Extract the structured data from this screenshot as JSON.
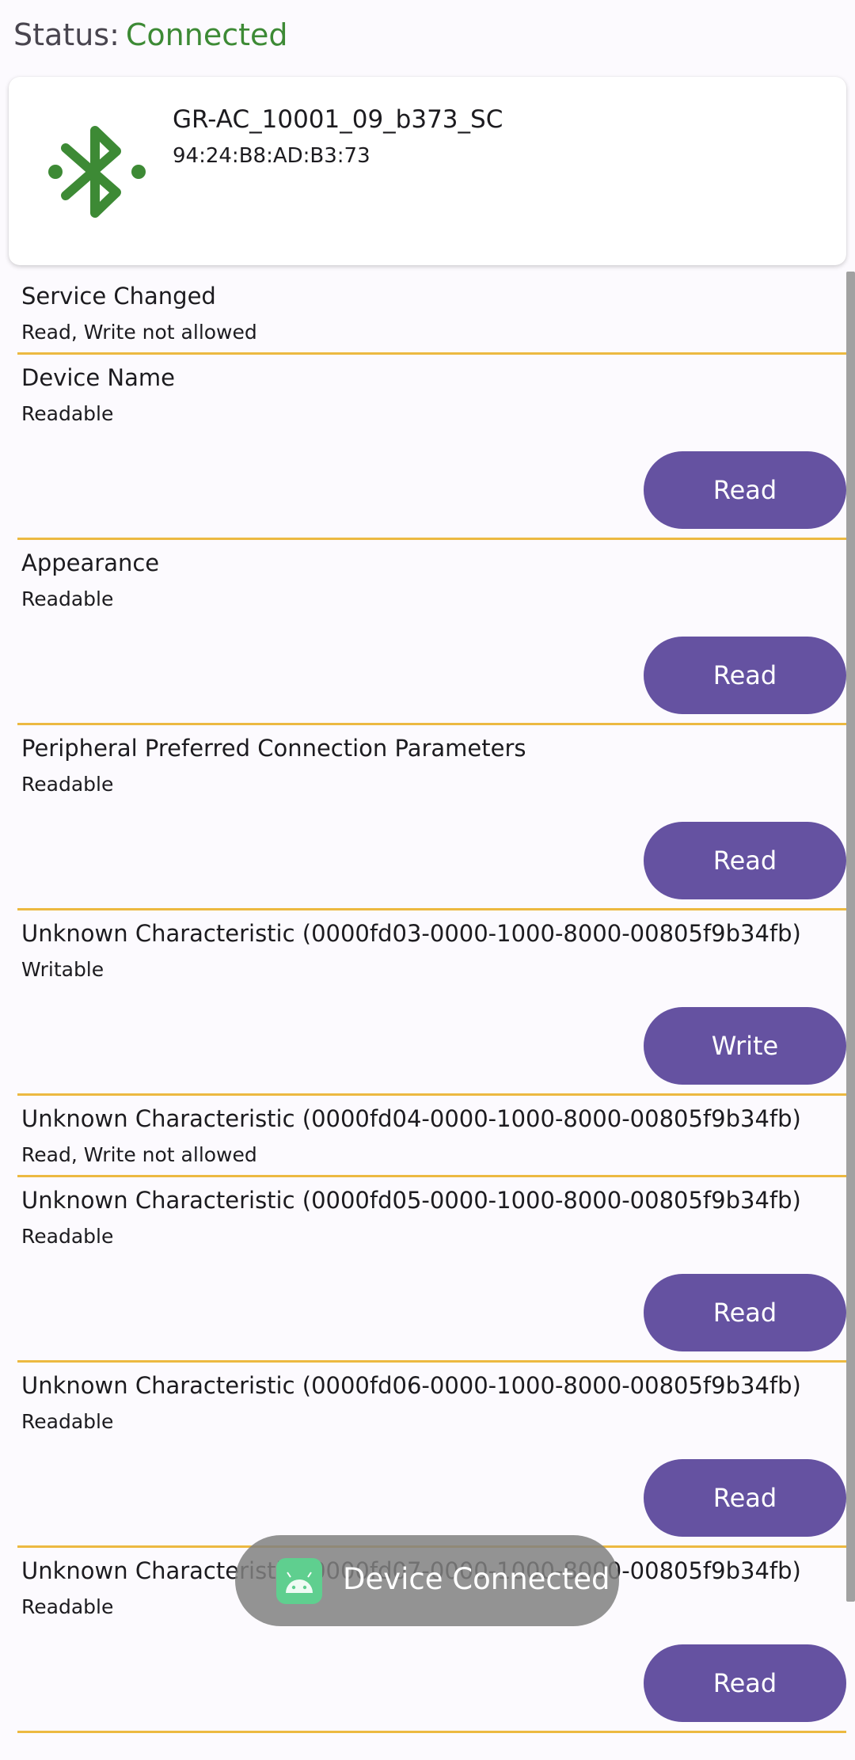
{
  "status": {
    "label": "Status:",
    "value": "Connected"
  },
  "device": {
    "name": "GR-AC_10001_09_b373_SC",
    "mac": "94:24:B8:AD:B3:73",
    "icon": "bluetooth-icon"
  },
  "characteristics": [
    {
      "name": "Service Changed",
      "property": "Read, Write not allowed",
      "action": ""
    },
    {
      "name": "Device Name",
      "property": "Readable",
      "action": "Read"
    },
    {
      "name": "Appearance",
      "property": "Readable",
      "action": "Read"
    },
    {
      "name": "Peripheral Preferred Connection Parameters",
      "property": "Readable",
      "action": "Read"
    },
    {
      "name": "Unknown Characteristic (0000fd03-0000-1000-8000-00805f9b34fb)",
      "property": "Writable",
      "action": "Write"
    },
    {
      "name": "Unknown Characteristic (0000fd04-0000-1000-8000-00805f9b34fb)",
      "property": "Read, Write not allowed",
      "action": ""
    },
    {
      "name": "Unknown Characteristic (0000fd05-0000-1000-8000-00805f9b34fb)",
      "property": "Readable",
      "action": "Read"
    },
    {
      "name": "Unknown Characteristic (0000fd06-0000-1000-8000-00805f9b34fb)",
      "property": "Readable",
      "action": "Read"
    },
    {
      "name": "Unknown Characteristic (0000fd07-0000-1000-8000-00805f9b34fb)",
      "property": "Readable",
      "action": "Read"
    }
  ],
  "toast": {
    "text": "Device Connected",
    "icon": "android-app-icon"
  },
  "colors": {
    "connected": "#3d8a35",
    "bluetooth": "#3d8a35",
    "button": "#6552a1",
    "divider": "#ecb941"
  }
}
